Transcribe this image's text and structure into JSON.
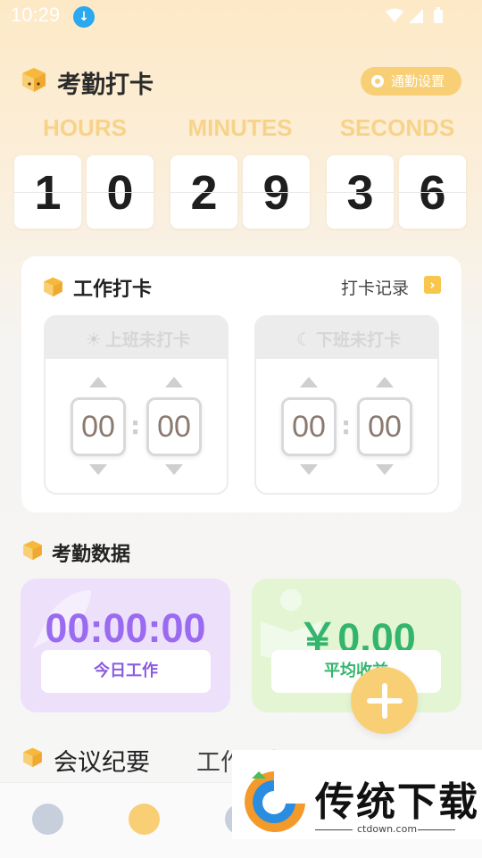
{
  "status_bar": {
    "time": "10:29"
  },
  "header": {
    "title": "考勤打卡",
    "settings_label": "通勤设置"
  },
  "clock": {
    "labels": [
      "HOURS",
      "MINUTES",
      "SECONDS"
    ],
    "digits": [
      "1",
      "0",
      "2",
      "9",
      "3",
      "6"
    ]
  },
  "work_card": {
    "title": "工作打卡",
    "records_link": "打卡记录",
    "checkin": {
      "label": "上班未打卡",
      "hour": "00",
      "minute": "00"
    },
    "checkout": {
      "label": "下班未打卡",
      "hour": "00",
      "minute": "00"
    }
  },
  "stats": {
    "title": "考勤数据",
    "work_time": {
      "value": "00:00:00",
      "label": "今日工作"
    },
    "income": {
      "value": "￥0.00",
      "label": "平均收益"
    }
  },
  "tabs": [
    "会议纪要",
    "工作计划"
  ],
  "watermark": {
    "brand": "传统下载",
    "url": "ctdown.com"
  },
  "colors": {
    "accent": "#f8cf75",
    "purple": "#9a6af0",
    "green": "#34b56e"
  }
}
